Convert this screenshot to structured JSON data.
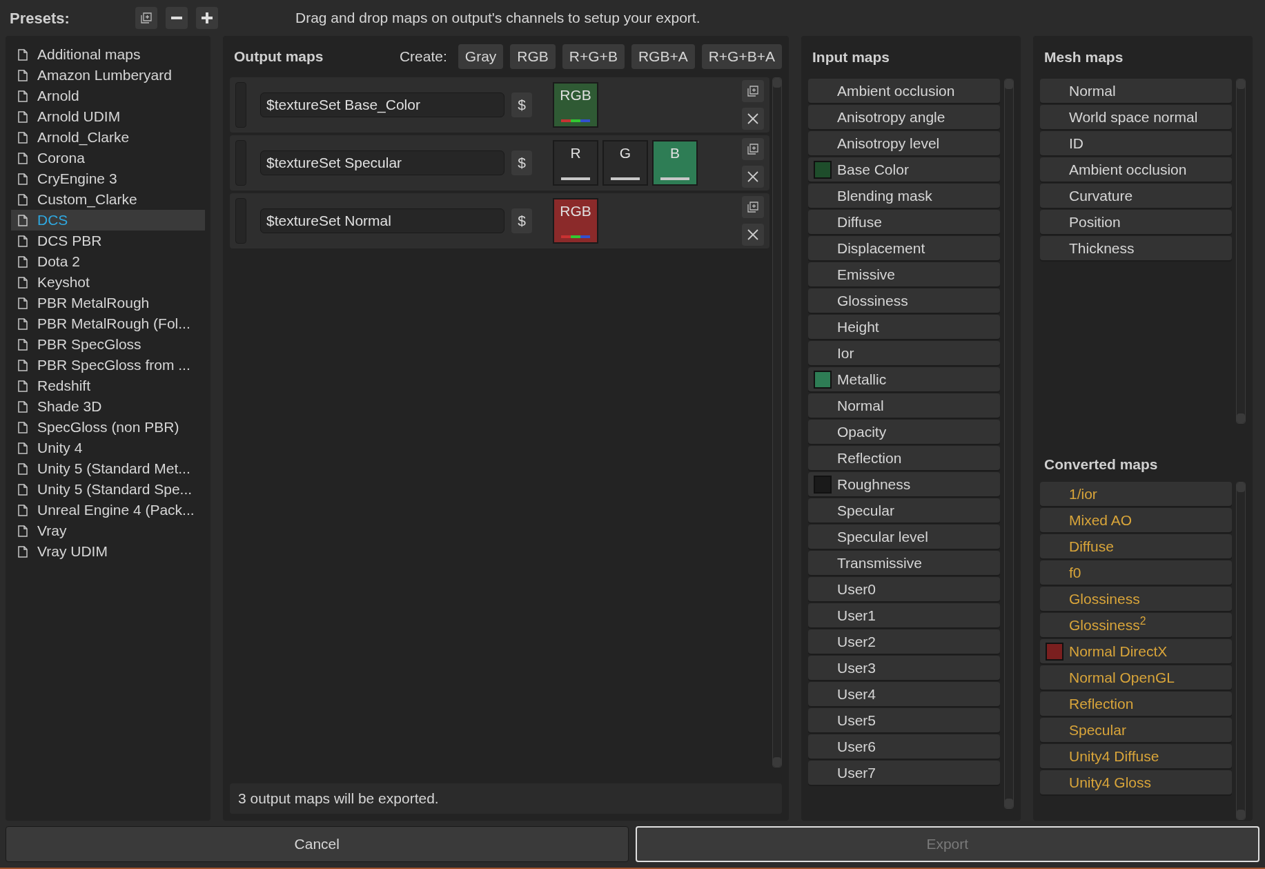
{
  "presets": {
    "title": "Presets:",
    "hint": "Drag and drop maps on output's channels to setup your export.",
    "items": [
      {
        "label": "Additional maps",
        "selected": false
      },
      {
        "label": "Amazon Lumberyard",
        "selected": false
      },
      {
        "label": "Arnold",
        "selected": false
      },
      {
        "label": "Arnold UDIM",
        "selected": false
      },
      {
        "label": "Arnold_Clarke",
        "selected": false
      },
      {
        "label": "Corona",
        "selected": false
      },
      {
        "label": "CryEngine 3",
        "selected": false
      },
      {
        "label": "Custom_Clarke",
        "selected": false
      },
      {
        "label": "DCS",
        "selected": true
      },
      {
        "label": "DCS PBR",
        "selected": false
      },
      {
        "label": "Dota 2",
        "selected": false
      },
      {
        "label": "Keyshot",
        "selected": false
      },
      {
        "label": "PBR MetalRough",
        "selected": false
      },
      {
        "label": "PBR MetalRough (Fol...",
        "selected": false
      },
      {
        "label": "PBR SpecGloss",
        "selected": false
      },
      {
        "label": "PBR SpecGloss from ...",
        "selected": false
      },
      {
        "label": "Redshift",
        "selected": false
      },
      {
        "label": "Shade 3D",
        "selected": false
      },
      {
        "label": "SpecGloss (non PBR)",
        "selected": false
      },
      {
        "label": "Unity 4",
        "selected": false
      },
      {
        "label": "Unity 5 (Standard Met...",
        "selected": false
      },
      {
        "label": "Unity 5 (Standard Spe...",
        "selected": false
      },
      {
        "label": "Unreal Engine 4 (Pack...",
        "selected": false
      },
      {
        "label": "Vray",
        "selected": false
      },
      {
        "label": "Vray UDIM",
        "selected": false
      }
    ]
  },
  "output_maps": {
    "title": "Output maps",
    "create_label": "Create:",
    "create_buttons": [
      "Gray",
      "RGB",
      "R+G+B",
      "RGB+A",
      "R+G+B+A"
    ],
    "maps": [
      {
        "name": "$textureSet Base_Color",
        "dollar": "$",
        "channels": [
          {
            "label": "RGB",
            "kind": "rgb",
            "color": "#2f5a34"
          }
        ]
      },
      {
        "name": "$textureSet Specular",
        "dollar": "$",
        "channels": [
          {
            "label": "R",
            "kind": "single"
          },
          {
            "label": "G",
            "kind": "single"
          },
          {
            "label": "B",
            "kind": "single",
            "color": "#2e7d55"
          }
        ]
      },
      {
        "name": "$textureSet Normal",
        "dollar": "$",
        "channels": [
          {
            "label": "RGB",
            "kind": "rgb",
            "color": "#8b2a2a"
          }
        ]
      }
    ],
    "status": "3 output maps will be exported."
  },
  "input_maps": {
    "title": "Input maps",
    "items": [
      {
        "label": "Ambient occlusion"
      },
      {
        "label": "Anisotropy angle"
      },
      {
        "label": "Anisotropy level"
      },
      {
        "label": "Base Color",
        "color": "#1e4d2b"
      },
      {
        "label": "Blending mask"
      },
      {
        "label": "Diffuse"
      },
      {
        "label": "Displacement"
      },
      {
        "label": "Emissive"
      },
      {
        "label": "Glossiness"
      },
      {
        "label": "Height"
      },
      {
        "label": "Ior"
      },
      {
        "label": "Metallic",
        "color": "#2e7d55"
      },
      {
        "label": "Normal"
      },
      {
        "label": "Opacity"
      },
      {
        "label": "Reflection"
      },
      {
        "label": "Roughness",
        "color": "#1a1a1a"
      },
      {
        "label": "Specular"
      },
      {
        "label": "Specular level"
      },
      {
        "label": "Transmissive"
      },
      {
        "label": "User0"
      },
      {
        "label": "User1"
      },
      {
        "label": "User2"
      },
      {
        "label": "User3"
      },
      {
        "label": "User4"
      },
      {
        "label": "User5"
      },
      {
        "label": "User6"
      },
      {
        "label": "User7"
      }
    ]
  },
  "mesh_maps": {
    "title": "Mesh maps",
    "items": [
      {
        "label": "Normal"
      },
      {
        "label": "World space normal"
      },
      {
        "label": "ID"
      },
      {
        "label": "Ambient occlusion"
      },
      {
        "label": "Curvature"
      },
      {
        "label": "Position"
      },
      {
        "label": "Thickness"
      }
    ]
  },
  "converted_maps": {
    "title": "Converted maps",
    "items": [
      {
        "label": "1/ior"
      },
      {
        "label": "Mixed AO"
      },
      {
        "label": "Diffuse"
      },
      {
        "label": "f0"
      },
      {
        "label": "Glossiness"
      },
      {
        "label": "Glossiness$^{2}$"
      },
      {
        "label": "Normal DirectX",
        "color": "#7a1f1f"
      },
      {
        "label": "Normal OpenGL"
      },
      {
        "label": "Reflection"
      },
      {
        "label": "Specular"
      },
      {
        "label": "Unity4 Diffuse"
      },
      {
        "label": "Unity4 Gloss"
      }
    ]
  },
  "buttons": [
    {
      "label": "Cancel",
      "disabled": false
    },
    {
      "label": "Export",
      "disabled": true
    }
  ]
}
